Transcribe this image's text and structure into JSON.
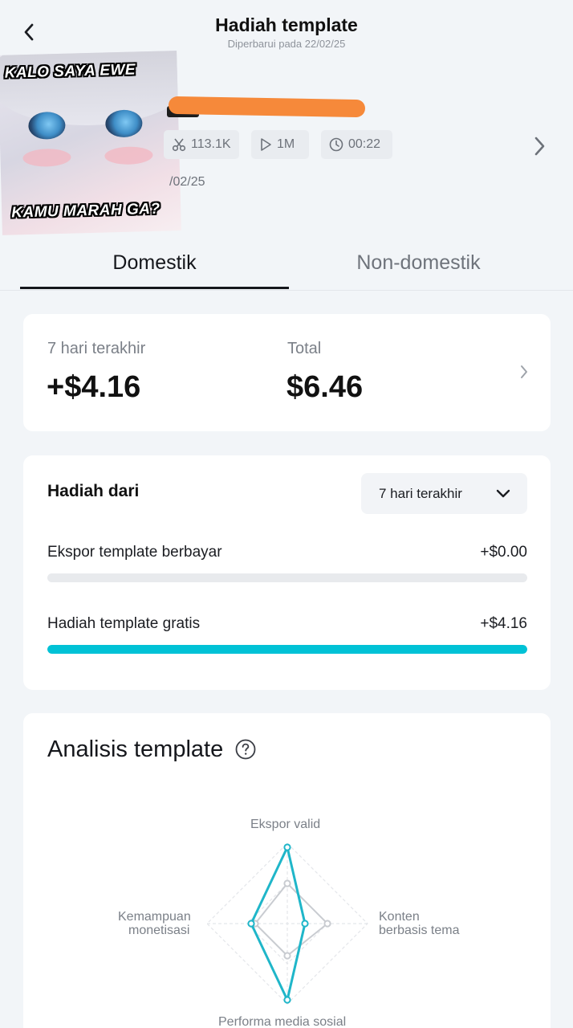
{
  "header": {
    "title": "Hadiah template",
    "updated": "Diperbarui pada 22/02/25"
  },
  "template": {
    "thumbnail_caption_top": "KALO SAYA EWE",
    "thumbnail_caption_bottom": "KAMU MARAH GA?",
    "uses": "113.1K",
    "plays": "1M",
    "duration": "00:22",
    "date_partial": "/02/25"
  },
  "tabs": [
    {
      "label": "Domestik",
      "active": true
    },
    {
      "label": "Non-domestik",
      "active": false
    }
  ],
  "summary": {
    "last7_label": "7 hari terakhir",
    "last7_value": "+$4.16",
    "total_label": "Total",
    "total_value": "$6.46"
  },
  "reward_source": {
    "title": "Hadiah dari",
    "period_selected": "7 hari terakhir",
    "rows": [
      {
        "label": "Ekspor template berbayar",
        "value": "+$0.00",
        "fraction": 0.0
      },
      {
        "label": "Hadiah template gratis",
        "value": "+$4.16",
        "fraction": 1.0
      }
    ]
  },
  "analysis": {
    "title": "Analisis template",
    "axes": {
      "top": "Ekspor valid",
      "right_line1": "Konten",
      "right_line2": "berbasis tema",
      "left_line1": "Kemampuan",
      "left_line2": "monetisasi",
      "bottom": "Performa media sosial"
    }
  },
  "chart_data": {
    "type": "radar",
    "axes": [
      "Ekspor valid",
      "Konten berbasis tema",
      "Performa media sosial",
      "Kemampuan monetisasi"
    ],
    "series": [
      {
        "values": [
          0.95,
          0.22,
          0.95,
          0.45
        ],
        "color": "#1fb6c9"
      },
      {
        "values": [
          0.5,
          0.5,
          0.4,
          0.4
        ],
        "color": "#c9ccd1"
      }
    ]
  },
  "colors": {
    "accent": "#00c2d6",
    "highlight_scribble": "#f6893a"
  }
}
